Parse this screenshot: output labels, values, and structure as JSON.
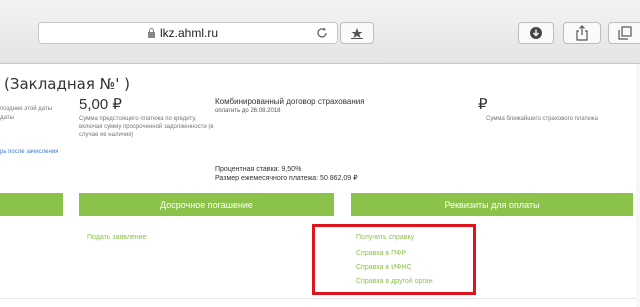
{
  "browser": {
    "url": "lkz.ahml.ru"
  },
  "page": {
    "title": "(Закладная №'                    )",
    "left_notes": [
      "позднее этой даты",
      "даты"
    ],
    "left_link": "рь после зачисления",
    "payment_amount": "5,00 ₽",
    "payment_desc": "Сумма предстоящего платежа по кредиту, включая сумму просроченной задолженности (в случае ее наличия)",
    "insurance_title": "Комбинированный договор страхования",
    "insurance_date": "оплатить до 26.08.2018",
    "interest_rate": "Процентная ставка: 9,50%",
    "monthly_payment": "Размер ежемесячного платежа: 50 862,09 ₽",
    "next_insurance_value": "₽",
    "next_insurance_desc": "Сумма ближайшего страхового платежа",
    "early_repayment_button": "Досрочное погашение",
    "requisites_button": "Реквизиты для оплаты",
    "submit_request_link": "Подать заявление",
    "certificate_links": [
      "Получить справку",
      "Справка в ПФР",
      "Справка в ИФНС",
      "Справка в другой орган"
    ]
  },
  "colors": {
    "accent_green": "#8bc34a",
    "highlight_red": "#e0151b"
  }
}
